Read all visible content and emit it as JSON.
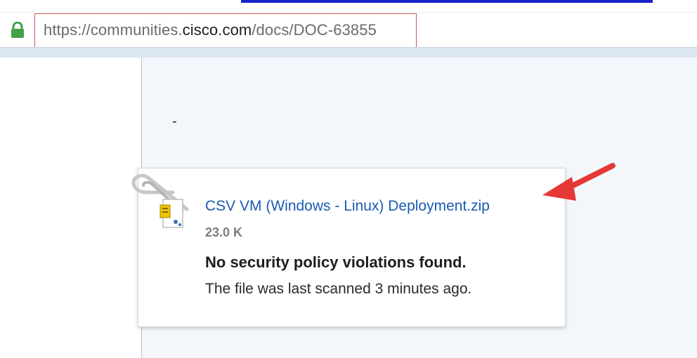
{
  "browser": {
    "url_scheme_host_prefix": "https://communities.",
    "url_domain_emphasis": "cisco.com",
    "url_path": "/docs/DOC-63855"
  },
  "content": {
    "separator_text": "-"
  },
  "attachment": {
    "file_name": "CSV VM (Windows - Linux) Deployment.zip",
    "file_size": "23.0 K",
    "security_status": "No security policy violations found.",
    "scan_info": "The file was last scanned 3 minutes ago."
  },
  "icons": {
    "lock": "lock-icon",
    "paperclip": "paperclip-icon",
    "file": "zip-file-icon",
    "arrow": "red-arrow-annotation"
  },
  "colors": {
    "link": "#1b5bb3",
    "lock": "#43a047",
    "highlight_box": "#d9535a",
    "arrow": "#e53935",
    "content_bg": "#f3f7fc"
  }
}
